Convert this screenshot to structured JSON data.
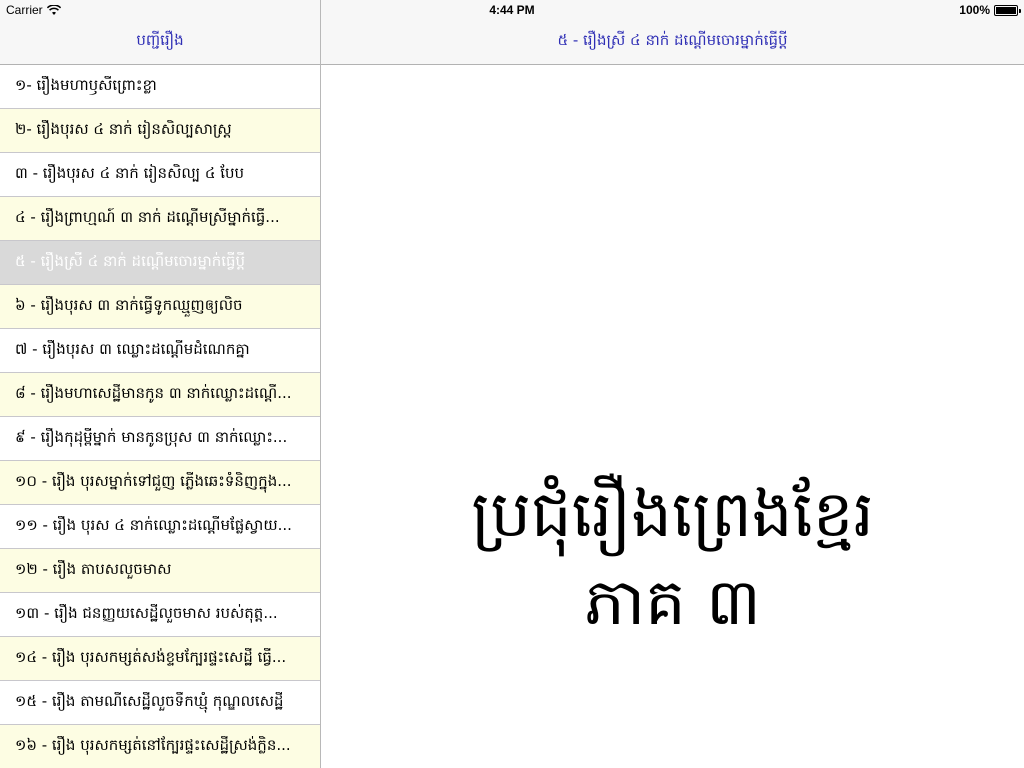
{
  "status": {
    "carrier": "Carrier",
    "time": "4:44 PM",
    "battery": "100%",
    "battery_level": 1.0
  },
  "sidebar": {
    "title": "បញ្ជីរឿង",
    "items": [
      {
        "label": "១- រឿងមហាឫសីព្រោះខ្លា"
      },
      {
        "label": "២- រឿងបុរស ៤ នាក់ រៀនសិល្បសាស្ត្រ"
      },
      {
        "label": "៣ - រឿងបុរស ៤ នាក់ រៀនសិល្ប ៤ បែប"
      },
      {
        "label": "៤ - រឿងព្រាហ្មណ៍ ៣ នាក់ ដណ្ដើមស្រីម្នាក់ធ្វើ..."
      },
      {
        "label": "៥ - រឿងស្រី ៤ នាក់ ដណ្ដើមចោរម្នាក់ធ្វើប្ដី"
      },
      {
        "label": "៦ - រឿងបុរស ៣ នាក់ធ្វើទូកឈ្មួញឲ្យលិច"
      },
      {
        "label": "៧ - រឿងបុរស ៣ ឈ្លោះដណ្ដើមដំណេកគ្នា"
      },
      {
        "label": "៨ - រឿងមហាសេដ្ឋីមានកូន ៣ នាក់ឈ្លោះដណ្ដើ..."
      },
      {
        "label": "៩ - រឿងកុដុម្ពីម្នាក់ មានកូនប្រុស ៣ នាក់ឈ្លោះ..."
      },
      {
        "label": "១០ - រឿង បុរសម្នាក់ទៅជួញ ភ្លើងឆេះទំនិញក្នុង..."
      },
      {
        "label": "១១ - រឿង បុរស ៤ នាក់ឈ្លោះដណ្ដើមផ្លែស្វាយ..."
      },
      {
        "label": "១២ - រឿង តាបសលួចមាស"
      },
      {
        "label": "១៣ - រឿង ជនញ្ញយសេដ្ឋីលួចមាស របស់តុត្ត..."
      },
      {
        "label": "១៤ - រឿង បុរសកម្សត់សង់ខ្ទមក្បែរផ្ទះសេដ្ឋី ធ្វើ..."
      },
      {
        "label": "១៥ - រឿង តាមណីសេដ្ឋីលួចទឹកឃ្មុំ កុណ្ឌលសេដ្ឋី"
      },
      {
        "label": "១៦ - រឿង បុរសកម្សត់នៅក្បែរផ្ទះសេដ្ឋីស្រង់ក្លិន..."
      }
    ],
    "selected_index": 4
  },
  "detail": {
    "title": "៥ - រឿងស្រី ៤ នាក់ ដណ្ដើមចោរម្នាក់ធ្វើប្ដី",
    "heading": "ប្រជុំរឿងព្រេងខ្មែរ",
    "subheading": "ភាគ ៣"
  },
  "colors": {
    "nav_text": "#2f2fb5",
    "alt_row": "#fdfde3",
    "selected_row": "#d9d9d9"
  }
}
